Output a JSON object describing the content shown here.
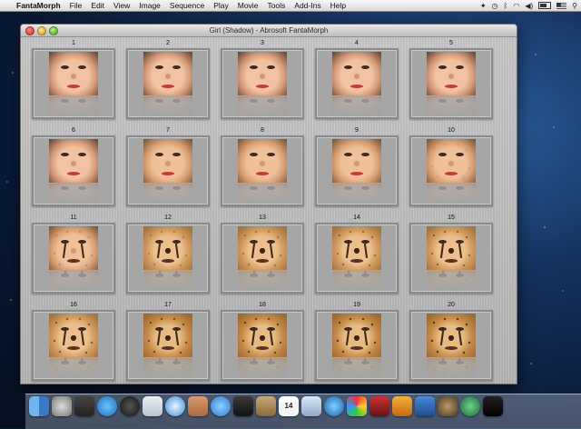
{
  "menubar": {
    "app_name": "FantaMorph",
    "items": [
      "File",
      "Edit",
      "View",
      "Image",
      "Sequence",
      "Play",
      "Movie",
      "Tools",
      "Add-Ins",
      "Help"
    ]
  },
  "window": {
    "title": "Girl (Shadow) - Abrosoft FantaMorph"
  },
  "frames": [
    {
      "number": "1",
      "morph": 0.0
    },
    {
      "number": "2",
      "morph": 0.05
    },
    {
      "number": "3",
      "morph": 0.1
    },
    {
      "number": "4",
      "morph": 0.15
    },
    {
      "number": "5",
      "morph": 0.2
    },
    {
      "number": "6",
      "morph": 0.26
    },
    {
      "number": "7",
      "morph": 0.32
    },
    {
      "number": "8",
      "morph": 0.37
    },
    {
      "number": "9",
      "morph": 0.42
    },
    {
      "number": "10",
      "morph": 0.47
    },
    {
      "number": "11",
      "morph": 0.53
    },
    {
      "number": "12",
      "morph": 0.58
    },
    {
      "number": "13",
      "morph": 0.63
    },
    {
      "number": "14",
      "morph": 0.68
    },
    {
      "number": "15",
      "morph": 0.74
    },
    {
      "number": "16",
      "morph": 0.79
    },
    {
      "number": "17",
      "morph": 0.84
    },
    {
      "number": "18",
      "morph": 0.89
    },
    {
      "number": "19",
      "morph": 0.95
    },
    {
      "number": "20",
      "morph": 1.0
    }
  ],
  "dock": {
    "calendar_day": "14",
    "items": [
      "finder-icon",
      "launchpad-icon",
      "mission-control-icon",
      "app-store-icon",
      "dashboard-icon",
      "mail-icon",
      "safari-icon",
      "fantamorph-icon",
      "ichat-icon",
      "facetime-icon",
      "address-book-icon",
      "calendar-icon",
      "preview-icon",
      "itunes-icon",
      "photo-booth-icon",
      "photo-icon",
      "iphoto-icon",
      "xcode-icon",
      "instruments-icon",
      "time-machine-icon",
      "terminal-icon"
    ]
  }
}
